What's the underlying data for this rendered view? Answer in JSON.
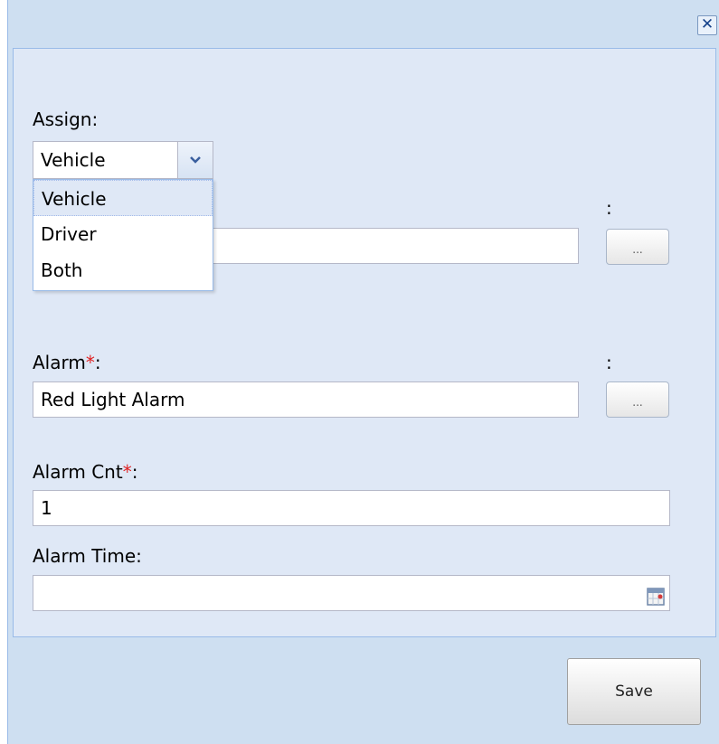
{
  "window": {
    "close_glyph": "✕"
  },
  "form": {
    "assign_label": "Assign:",
    "assign_value": "Vehicle",
    "assign_options": [
      "Vehicle",
      "Driver",
      "Both"
    ],
    "target_colon": ":",
    "target_value": "",
    "target_browse_label": "...",
    "alarm_label": "Alarm",
    "alarm_required": "*",
    "alarm_colon_suffix": ":",
    "alarm_colon": ":",
    "alarm_value": "Red Light Alarm",
    "alarm_browse_label": "...",
    "alarm_cnt_label": "Alarm Cnt",
    "alarm_cnt_required": "*",
    "alarm_cnt_colon_suffix": ":",
    "alarm_cnt_value": "1",
    "alarm_time_label": "Alarm Time:",
    "alarm_time_value": ""
  },
  "footer": {
    "save_label": "Save"
  },
  "icons": {
    "close": "close-icon",
    "combo": "chevron-down-icon",
    "date": "calendar-icon"
  },
  "colors": {
    "window_bg": "#cedff1",
    "panel_bg": "#dfe8f6",
    "required": "#e02020",
    "border": "#99bbe8"
  }
}
